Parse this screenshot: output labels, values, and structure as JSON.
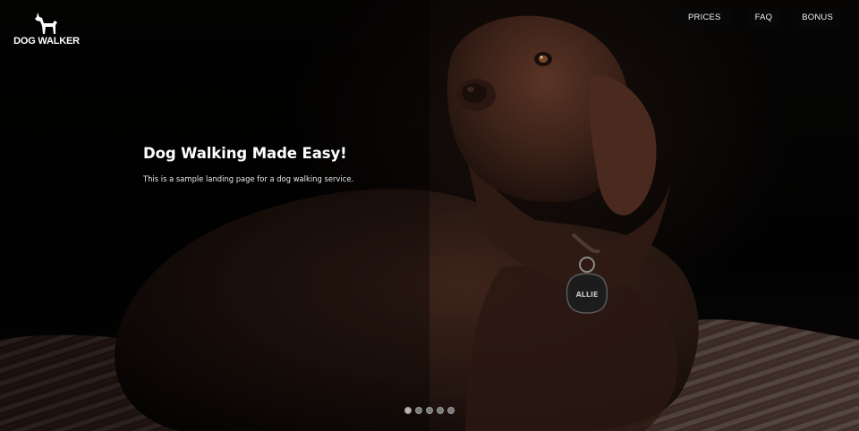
{
  "brand": {
    "name": "DOG WALKER",
    "logo_icon": "dog-silhouette-icon"
  },
  "nav": {
    "items": [
      {
        "label": "PRICES"
      },
      {
        "label": "FAQ"
      },
      {
        "label": "BONUS"
      }
    ]
  },
  "hero": {
    "headline": "Dog Walking Made Easy!",
    "subline": "This is a sample landing page for a dog walking service.",
    "image": {
      "subject": "chocolate-labrador-dog-photo",
      "tag_text": "ALLIE"
    }
  },
  "carousel": {
    "slide_count": 5,
    "active_index": 0
  },
  "colors": {
    "background": "#000000",
    "text": "#ffffff",
    "dog_fur": "#3a2118",
    "dot": "#7a7a7a",
    "dot_active": "#b5b5b5"
  }
}
